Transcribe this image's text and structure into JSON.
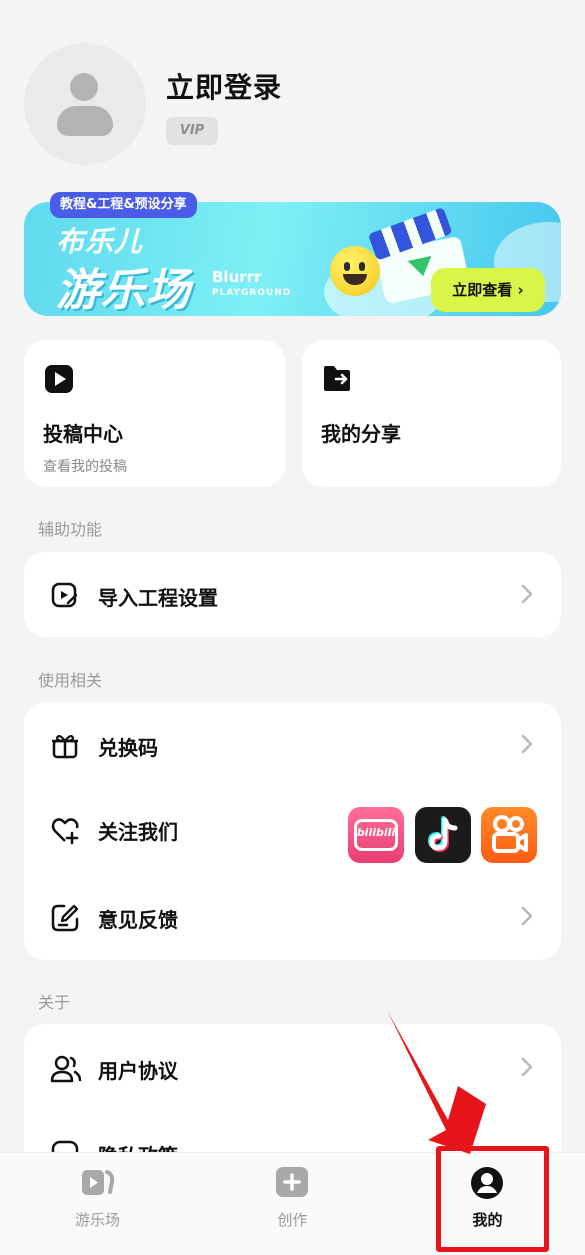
{
  "profile": {
    "login_label": "立即登录",
    "vip_badge": "VIP"
  },
  "banner": {
    "tag": "教程&工程&预设分享",
    "brand_top": "布乐儿",
    "brand_main": "游乐场",
    "brand_en": "Blurrr",
    "brand_en_sub": "PLAYGROUND",
    "cta": "立即查看 ›"
  },
  "quick_cards": [
    {
      "title": "投稿中心",
      "subtitle": "查看我的投稿",
      "icon": "play-square-icon"
    },
    {
      "title": "我的分享",
      "icon": "folder-share-icon"
    }
  ],
  "sections": {
    "assist": {
      "label": "辅助功能",
      "items": [
        {
          "label": "导入工程设置",
          "icon": "import-project-icon"
        }
      ]
    },
    "usage": {
      "label": "使用相关",
      "items": [
        {
          "label": "兑换码",
          "icon": "gift-icon"
        },
        {
          "label": "关注我们",
          "icon": "heart-plus-icon",
          "socials": [
            "bilibili",
            "tiktok",
            "kuaishou"
          ]
        },
        {
          "label": "意见反馈",
          "icon": "feedback-edit-icon"
        }
      ]
    },
    "about": {
      "label": "关于",
      "items": [
        {
          "label": "用户协议",
          "icon": "users-icon"
        },
        {
          "label": "隐私政策",
          "icon": "privacy-icon"
        }
      ]
    }
  },
  "social_text": {
    "bilibili": "bilibili"
  },
  "tabbar": {
    "items": [
      {
        "label": "游乐场",
        "icon": "playground-icon"
      },
      {
        "label": "创作",
        "icon": "create-plus-icon"
      },
      {
        "label": "我的",
        "icon": "profile-icon",
        "active": true
      }
    ]
  },
  "colors": {
    "accent_red": "#e8141c",
    "cta_lime": "#d8f548",
    "banner_tag": "#4a5be8"
  }
}
